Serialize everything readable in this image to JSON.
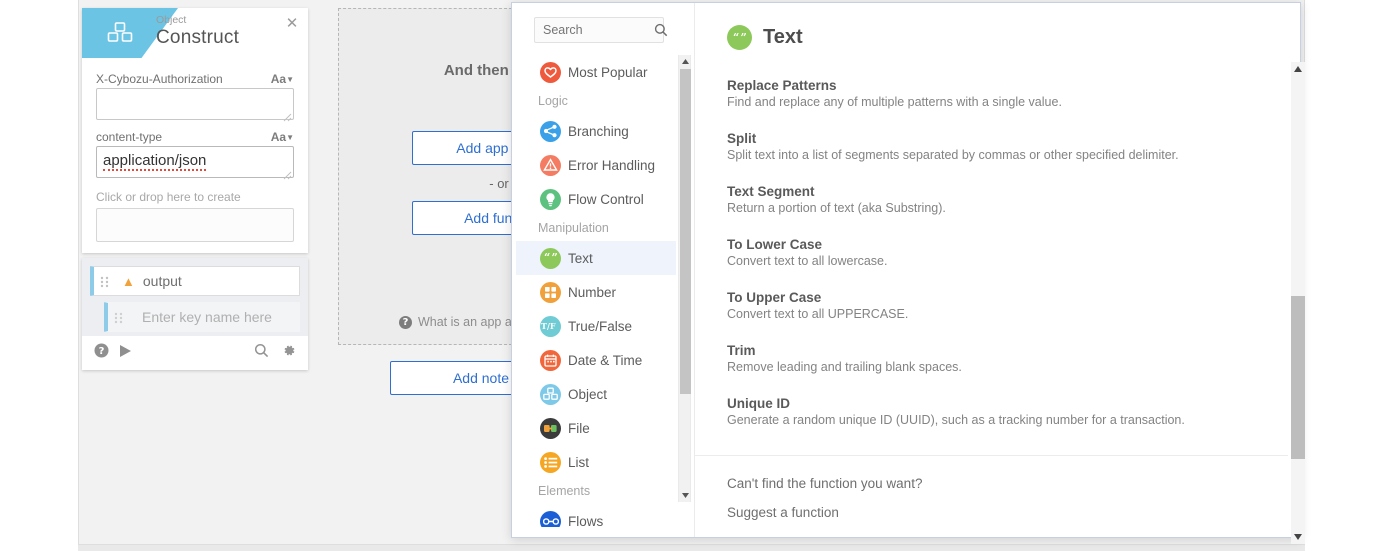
{
  "construct_card": {
    "subtitle": "Object",
    "title": "Construct",
    "close_icon": "close-icon",
    "header_icon": "cubes-icon",
    "fields": [
      {
        "label": "X-Cybozu-Authorization",
        "format_label": "Aa",
        "value": ""
      },
      {
        "label": "content-type",
        "format_label": "Aa",
        "value": "application/json",
        "misspelled": true
      }
    ],
    "create_hint": "Click or drop here to create"
  },
  "output_card": {
    "root_label": "output",
    "child_placeholder": "Enter key name here",
    "toolbar": {
      "help_icon": "help-icon",
      "run_icon": "play-icon",
      "search_icon": "search-icon",
      "settings_icon": "gear-icon"
    }
  },
  "step_box": {
    "title": "And then do this",
    "add_app_action_label": "Add app action",
    "or_label": "- or -",
    "add_function_label": "Add function",
    "help_text": "What is an app action or function?",
    "help_icon": "question-circle-icon"
  },
  "add_note_label": "Add note",
  "picker": {
    "search": {
      "placeholder": "Search",
      "value": "",
      "icon": "search-icon"
    },
    "list": [
      {
        "type": "item",
        "label": "Most Popular",
        "icon": "heart-icon",
        "color": "#ef5a3c",
        "active": false
      },
      {
        "type": "section",
        "label": "Logic"
      },
      {
        "type": "item",
        "label": "Branching",
        "icon": "share-icon",
        "color": "#3aa0e8",
        "active": false
      },
      {
        "type": "item",
        "label": "Error Handling",
        "icon": "warning-icon",
        "color": "#f47c62",
        "active": false
      },
      {
        "type": "item",
        "label": "Flow Control",
        "icon": "bulb-icon",
        "color": "#5dc27f",
        "active": false
      },
      {
        "type": "section",
        "label": "Manipulation"
      },
      {
        "type": "item",
        "label": "Text",
        "icon": "quotes-icon",
        "color": "#8cc95a",
        "active": true
      },
      {
        "type": "item",
        "label": "Number",
        "icon": "grid-icon",
        "color": "#f0a13b",
        "active": false
      },
      {
        "type": "item",
        "label": "True/False",
        "icon": "truefalse-icon",
        "color": "#6fcbd4",
        "active": false
      },
      {
        "type": "item",
        "label": "Date & Time",
        "icon": "calendar-icon",
        "color": "#f2663c",
        "active": false
      },
      {
        "type": "item",
        "label": "Object",
        "icon": "cubes-icon",
        "color": "#7ec8e8",
        "active": false
      },
      {
        "type": "item",
        "label": "File",
        "icon": "file-icon",
        "color": "#3b3b3b",
        "active": false
      },
      {
        "type": "item",
        "label": "List",
        "icon": "list-icon",
        "color": "#f5a623",
        "active": false
      },
      {
        "type": "section",
        "label": "Elements"
      },
      {
        "type": "item",
        "label": "Flows",
        "icon": "flows-icon",
        "color": "#1a5fd6",
        "active": false
      }
    ],
    "detail": {
      "icon": "quotes-icon",
      "icon_color": "#8cc95a",
      "title": "Text",
      "functions": [
        {
          "name": "Replace Patterns",
          "desc": "Find and replace any of multiple patterns with a single value."
        },
        {
          "name": "Split",
          "desc": "Split text into a list of segments separated by commas or other specified delimiter."
        },
        {
          "name": "Text Segment",
          "desc": "Return a portion of text (aka Substring)."
        },
        {
          "name": "To Lower Case",
          "desc": "Convert text to all lowercase."
        },
        {
          "name": "To Upper Case",
          "desc": "Convert text to all UPPERCASE."
        },
        {
          "name": "Trim",
          "desc": "Remove leading and trailing blank spaces."
        },
        {
          "name": "Unique ID",
          "desc": "Generate a random unique ID (UUID), such as a tracking number for a transaction."
        }
      ],
      "footer_question": "Can't find the function you want?",
      "footer_link": "Suggest a function"
    }
  },
  "colors": {
    "accent_blue": "#1a73e8",
    "header_blue": "#6cc4e5",
    "button_blue": "#2f6fd0",
    "canvas_bg": "#f2f2f2"
  }
}
